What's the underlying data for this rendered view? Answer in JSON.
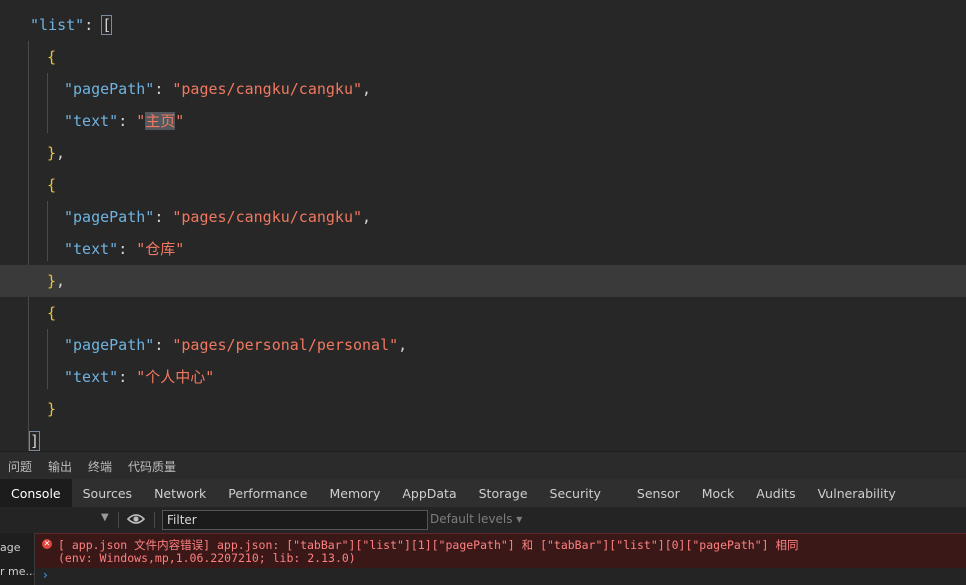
{
  "editor": {
    "lines": [
      {
        "indent": 0,
        "tokens": [
          {
            "t": "k",
            "v": "\"list\""
          },
          {
            "t": "p",
            "v": ": "
          },
          {
            "t": "brbox",
            "v": "["
          }
        ]
      },
      {
        "indent": 1,
        "tokens": [
          {
            "t": "b",
            "v": "{"
          }
        ]
      },
      {
        "indent": 2,
        "tokens": [
          {
            "t": "k",
            "v": "\"pagePath\""
          },
          {
            "t": "p",
            "v": ": "
          },
          {
            "t": "s",
            "v": "\"pages/cangku/cangku\""
          },
          {
            "t": "p",
            "v": ","
          }
        ]
      },
      {
        "indent": 2,
        "tokens": [
          {
            "t": "k",
            "v": "\"text\""
          },
          {
            "t": "p",
            "v": ": "
          },
          {
            "t": "s",
            "v": "\""
          },
          {
            "t": "sel",
            "v": "主页"
          },
          {
            "t": "s",
            "v": "\""
          }
        ]
      },
      {
        "indent": 1,
        "tokens": [
          {
            "t": "b",
            "v": "}"
          },
          {
            "t": "p",
            "v": ","
          }
        ]
      },
      {
        "indent": 1,
        "tokens": [
          {
            "t": "b",
            "v": "{"
          }
        ]
      },
      {
        "indent": 2,
        "tokens": [
          {
            "t": "k",
            "v": "\"pagePath\""
          },
          {
            "t": "p",
            "v": ": "
          },
          {
            "t": "s",
            "v": "\"pages/cangku/cangku\""
          },
          {
            "t": "p",
            "v": ","
          }
        ]
      },
      {
        "indent": 2,
        "tokens": [
          {
            "t": "k",
            "v": "\"text\""
          },
          {
            "t": "p",
            "v": ": "
          },
          {
            "t": "s",
            "v": "\"仓库\""
          }
        ]
      },
      {
        "indent": 1,
        "current": true,
        "tokens": [
          {
            "t": "b",
            "v": "}"
          },
          {
            "t": "p",
            "v": ","
          }
        ]
      },
      {
        "indent": 1,
        "tokens": [
          {
            "t": "b",
            "v": "{"
          }
        ]
      },
      {
        "indent": 2,
        "tokens": [
          {
            "t": "k",
            "v": "\"pagePath\""
          },
          {
            "t": "p",
            "v": ": "
          },
          {
            "t": "s",
            "v": "\"pages/personal/personal\""
          },
          {
            "t": "p",
            "v": ","
          }
        ]
      },
      {
        "indent": 2,
        "tokens": [
          {
            "t": "k",
            "v": "\"text\""
          },
          {
            "t": "p",
            "v": ": "
          },
          {
            "t": "s",
            "v": "\"个人中心\""
          }
        ]
      },
      {
        "indent": 1,
        "tokens": [
          {
            "t": "b",
            "v": "}"
          }
        ]
      },
      {
        "indent": 0,
        "tokens": [
          {
            "t": "brbox",
            "v": "]"
          }
        ]
      }
    ]
  },
  "panel_tabs": [
    "问题",
    "输出",
    "终端",
    "代码质量"
  ],
  "devtools_tabs": [
    {
      "label": "Console",
      "active": true
    },
    {
      "label": "Sources"
    },
    {
      "label": "Network"
    },
    {
      "label": "Performance"
    },
    {
      "label": "Memory"
    },
    {
      "label": "AppData"
    },
    {
      "label": "Storage"
    },
    {
      "label": "Security"
    },
    {
      "label": "Sensor",
      "gap": true
    },
    {
      "label": "Mock"
    },
    {
      "label": "Audits"
    },
    {
      "label": "Vulnerability"
    }
  ],
  "toolbar": {
    "context_arrow": "▼",
    "filter_value": "Filter",
    "levels_label": "Default levels ▾"
  },
  "console": {
    "sidebar_items": [
      "age",
      "r me..."
    ],
    "error_line1": "[ app.json 文件内容错误] app.json: [\"tabBar\"][\"list\"][1][\"pagePath\"] 和 [\"tabBar\"][\"list\"][0][\"pagePath\"] 相同",
    "error_line2": "(env: Windows,mp,1.06.2207210; lib: 2.13.0)",
    "error_icon": "✕",
    "prompt_symbol": "›"
  },
  "colors": {
    "key": "#6fb3e0",
    "string": "#f07860",
    "brace": "#ecc33f",
    "error_bg": "#3a1818",
    "error_text": "#ff8080"
  }
}
